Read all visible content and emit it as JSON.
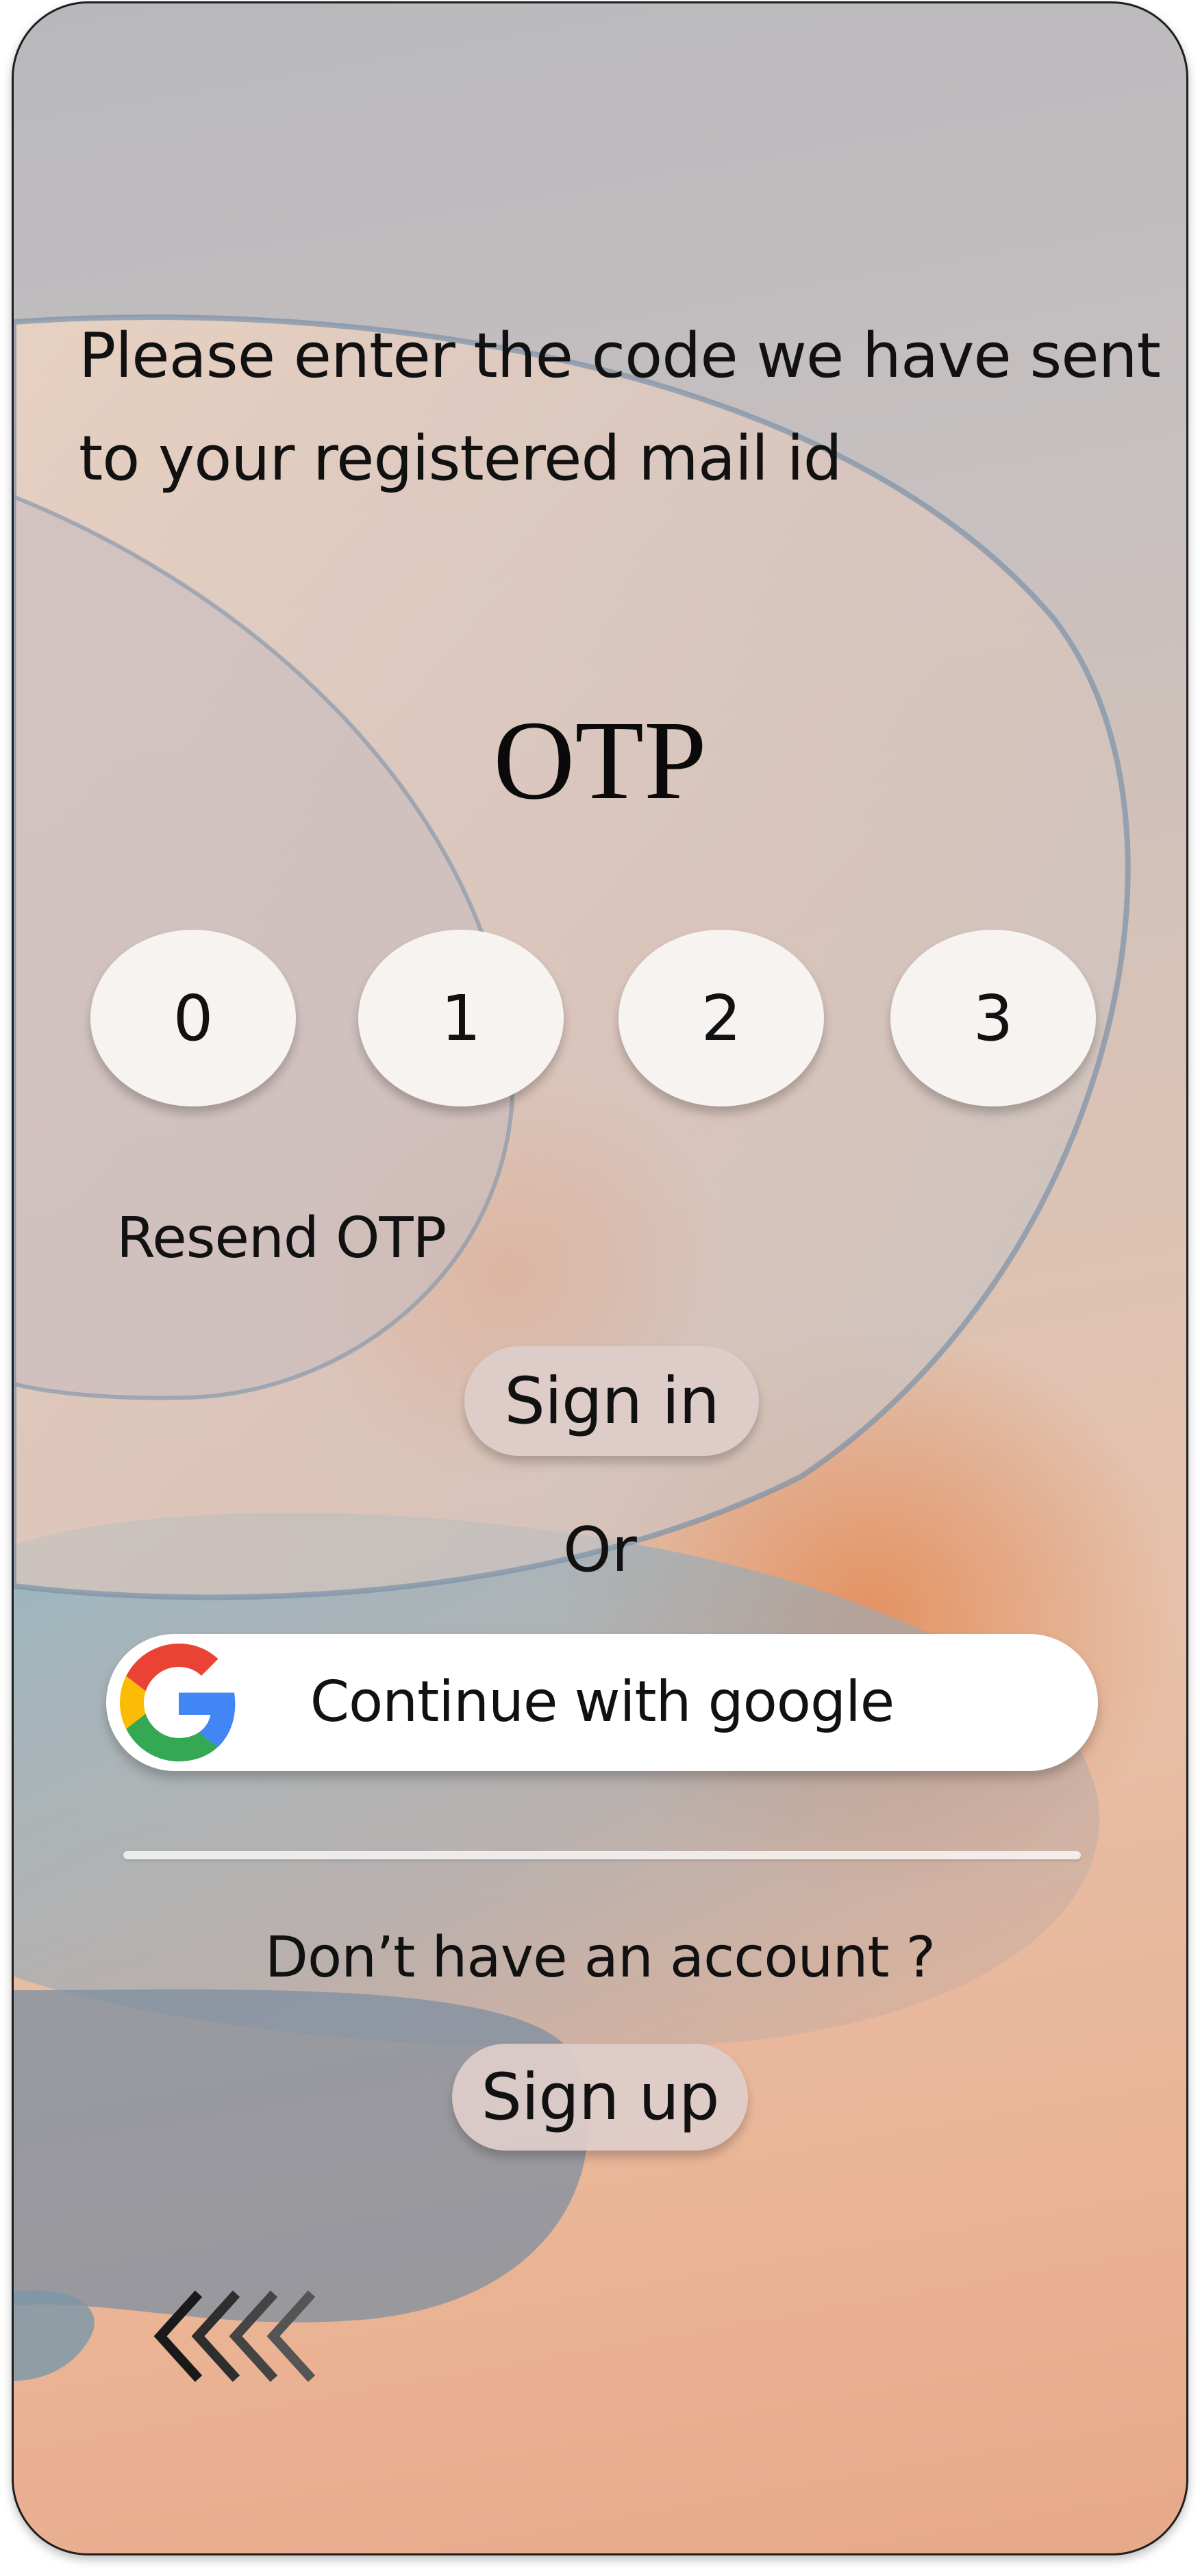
{
  "prompt": {
    "text": "Please enter the code we have sent to your registered mail id"
  },
  "otp": {
    "title": "OTP",
    "digits": [
      "0",
      "1",
      "2",
      "3"
    ],
    "resend_label": "Resend OTP"
  },
  "actions": {
    "sign_in_label": "Sign in",
    "or_label": "Or",
    "google_label": "Continue with google",
    "no_account_label": "Don’t have an account ?",
    "sign_up_label": "Sign up"
  },
  "icons": {
    "google": "google-logo-icon",
    "back": "chevrons-left-icon"
  },
  "colors": {
    "google_blue": "#4285F4",
    "google_red": "#EA4335",
    "google_yellow": "#FBBC05",
    "google_green": "#34A853"
  }
}
